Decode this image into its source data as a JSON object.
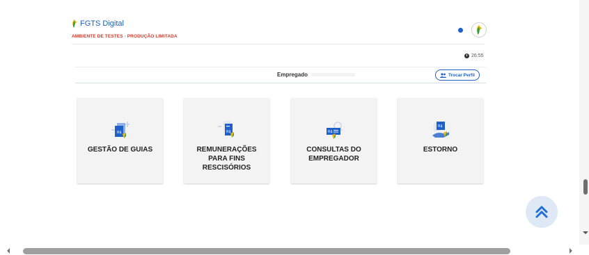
{
  "header": {
    "app_name": "FGTS Digital",
    "environment_banner": "AMBIENTE DE TESTES - PRODUÇÃO LIMITADA",
    "brand_blue": "#1f5fc8",
    "alert_red": "#d23a2b"
  },
  "session": {
    "timer": "26:55"
  },
  "profile_bar": {
    "employer_label": "Empregado",
    "switch_profile_label": "Trocar Perfil"
  },
  "cards": [
    {
      "id": "gestao-guias",
      "label": "GESTÃO DE GUIAS",
      "icon": "document-guides-icon"
    },
    {
      "id": "remuneracoes",
      "label": "REMUNERAÇÕES PARA FINS RESCISÓRIOS",
      "icon": "payment-document-icon"
    },
    {
      "id": "consultas",
      "label": "CONSULTAS DO EMPREGADOR",
      "icon": "search-payment-icon"
    },
    {
      "id": "estorno",
      "label": "ESTORNO",
      "icon": "refund-hand-icon"
    }
  ],
  "icons": {
    "scroll_top": "double-chevron-up-icon",
    "clock": "clock-icon"
  }
}
